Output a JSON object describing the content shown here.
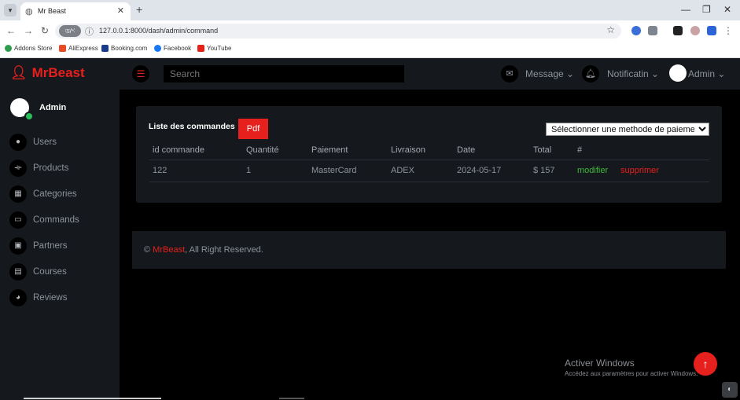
{
  "browser": {
    "tab_title": "Mr Beast",
    "url": "127.0.0.1:8000/dash/admin/command",
    "site_pill": "ড/ৼ",
    "bookmarks": [
      {
        "label": "Addons Store",
        "color": "#2e9c4a"
      },
      {
        "label": "AliExpress",
        "color": "#e94b26"
      },
      {
        "label": "Booking.com",
        "color": "#1b3c8c"
      },
      {
        "label": "Facebook",
        "color": "#1877f2"
      },
      {
        "label": "YouTube",
        "color": "#e62117"
      }
    ]
  },
  "header": {
    "brand": "MrBeast",
    "search_placeholder": "Search",
    "message_label": "Message",
    "notification_label": "Notificatin",
    "user_label": "Admin"
  },
  "sidebar": {
    "user": "Admin",
    "items": [
      {
        "label": "Users",
        "icon": "user-icon"
      },
      {
        "label": "Products",
        "icon": "dumbbell-icon"
      },
      {
        "label": "Categories",
        "icon": "grid-icon"
      },
      {
        "label": "Commands",
        "icon": "keyboard-icon"
      },
      {
        "label": "Partners",
        "icon": "id-card-icon"
      },
      {
        "label": "Courses",
        "icon": "file-icon"
      },
      {
        "label": "Reviews",
        "icon": "comments-icon"
      }
    ]
  },
  "orders": {
    "title": "Liste des commandes",
    "pdf_label": "Pdf",
    "payment_select": "Sélectionner une methode de paiement",
    "columns": [
      "id commande",
      "Quantité",
      "Paiement",
      "Livraison",
      "Date",
      "Total",
      "#"
    ],
    "rows": [
      {
        "id": "122",
        "quantity": "1",
        "payment": "MasterCard",
        "delivery": "ADEX",
        "date": "2024-05-17",
        "total": "$ 157",
        "edit": "modifier",
        "delete": "supprimer"
      }
    ]
  },
  "footer": {
    "symbol": "©",
    "brand": "MrBeast",
    "rights": ", All Right Reserved."
  },
  "os_watermark": {
    "title": "Activer Windows",
    "subtitle": "Accédez aux paramètres pour activer Windows."
  },
  "colors": {
    "accent": "#e6201d",
    "panel": "#15181c",
    "edit": "#3fba3c"
  }
}
